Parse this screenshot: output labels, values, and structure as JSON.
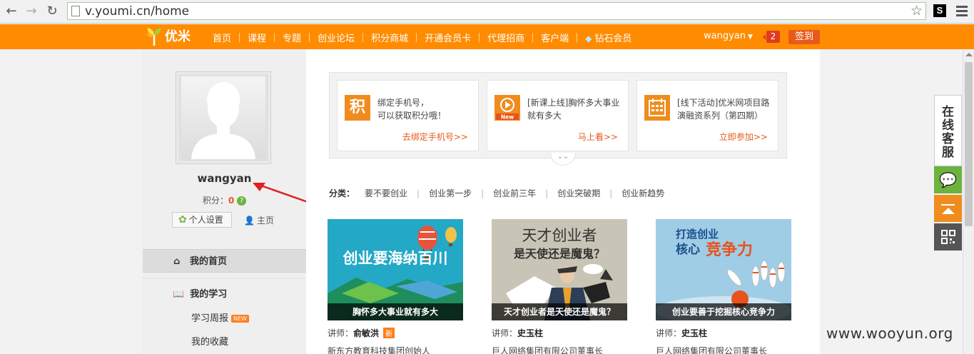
{
  "browser": {
    "url": "v.youmi.cn/home",
    "extension_label": "S"
  },
  "header": {
    "logo_text": "优米",
    "nav": [
      {
        "label": "首页"
      },
      {
        "label": "课程"
      },
      {
        "label": "专题"
      },
      {
        "label": "创业论坛"
      },
      {
        "label": "积分商城"
      },
      {
        "label": "开通会员卡"
      },
      {
        "label": "代理招商"
      },
      {
        "label": "客户端"
      },
      {
        "label": "钻石会员"
      }
    ],
    "username": "wangyan",
    "notification_count": "2",
    "checkin_label": "签到",
    "accent_color": "#ff8c00"
  },
  "sidebar": {
    "username": "wangyan",
    "points_label": "积分：",
    "points_value": "0",
    "settings_label": "个人设置",
    "homepage_label": "主页",
    "my_home": "我的首页",
    "my_learning": "我的学习",
    "weekly_report": "学习周报",
    "new_tag": "NEW",
    "favorites": "我的收藏"
  },
  "promos": [
    {
      "icon": "积",
      "line1": "绑定手机号，",
      "line2": "可以获取积分哦！",
      "link": "去绑定手机号>>"
    },
    {
      "icon": "New",
      "line1": "[新课上线]胸怀多大事业",
      "line2": "就有多大",
      "link": "马上看>>"
    },
    {
      "icon": "calendar",
      "line1": "[线下活动]优米网项目路",
      "line2": "演融资系列（第四期）",
      "link": "立即参加>>"
    }
  ],
  "categories": {
    "label": "分类：",
    "items": [
      "要不要创业",
      "创业第一步",
      "创业前三年",
      "创业突破期",
      "创业新趋势"
    ]
  },
  "courses": [
    {
      "image_text": "创业要海纳百川",
      "caption": "胸怀多大事业就有多大",
      "teacher_label": "讲师：",
      "teacher": "俞敏洪",
      "badge": "新",
      "org": "新东方教育科技集团创始人"
    },
    {
      "image_text_1": "天才创业者",
      "image_text_2": "是天使还是魔鬼？",
      "caption": "天才创业者是天使还是魔鬼？",
      "teacher_label": "讲师：",
      "teacher": "史玉柱",
      "org": "巨人网络集团有限公司董事长"
    },
    {
      "image_text_1": "打造创业",
      "image_text_2": "核心",
      "image_text_3": "竞争力",
      "caption": "创业要善于挖掘核心竞争力",
      "teacher_label": "讲师：",
      "teacher": "史玉柱",
      "org": "巨人网络集团有限公司董事长"
    }
  ],
  "service": {
    "label": "在线客服"
  },
  "watermark": "www.wooyun.org"
}
